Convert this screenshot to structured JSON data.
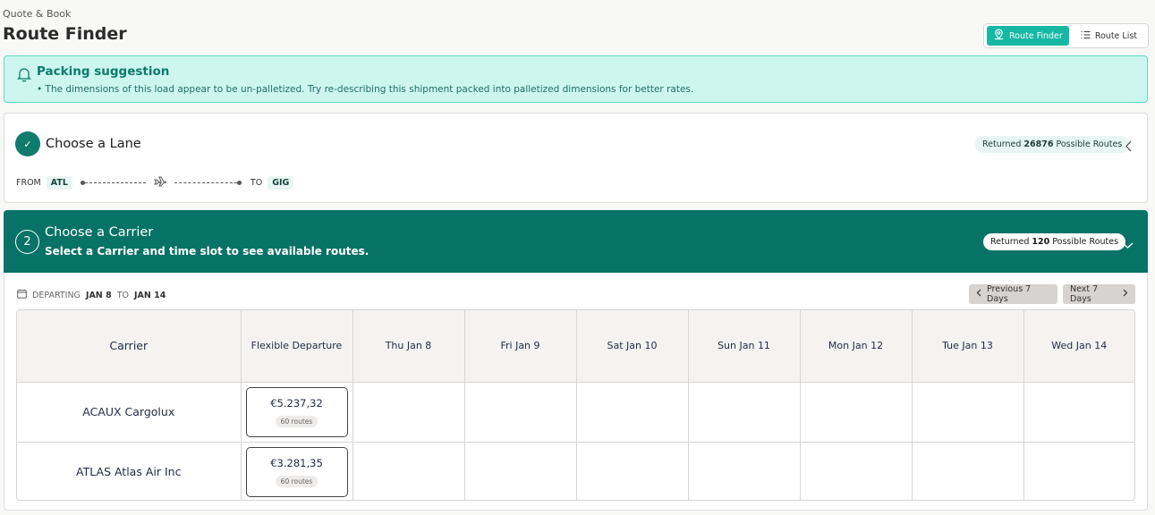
{
  "header": {
    "breadcrumb": "Quote & Book",
    "title": "Route Finder"
  },
  "view_toggle": {
    "route_finder": "Route Finder",
    "route_list": "Route List"
  },
  "alert": {
    "title": "Packing suggestion",
    "text": "• The dimensions of this load appear to be un-palletized. Try re-describing this shipment packed into palletized dimensions for better rates."
  },
  "lane": {
    "title": "Choose a Lane",
    "check_glyph": "✓",
    "returned_prefix": "Returned",
    "returned_count": "26876",
    "returned_suffix": "Possible Routes",
    "from_label": "FROM",
    "from_code": "ATL",
    "to_label": "TO",
    "to_code": "GIG"
  },
  "carrier_step": {
    "step_number": "2",
    "title": "Choose a Carrier",
    "subtitle": "Select a Carrier and time slot to see available routes.",
    "returned_prefix": "Returned",
    "returned_count": "120",
    "returned_suffix": "Possible Routes"
  },
  "schedule": {
    "departing_label": "DEPARTING",
    "from_date": "JAN 8",
    "to_word": "TO",
    "to_date": "JAN 14",
    "prev_label": "Previous 7 Days",
    "next_label": "Next 7 Days"
  },
  "table": {
    "columns": [
      "Carrier",
      "Flexible Departure",
      "Thu Jan 8",
      "Fri Jan 9",
      "Sat Jan 10",
      "Sun Jan 11",
      "Mon Jan 12",
      "Tue Jan 13",
      "Wed Jan 14"
    ],
    "rows": [
      {
        "carrier": "ACAUX Cargolux",
        "price": "€5.237,32",
        "routes": "60 routes"
      },
      {
        "carrier": "ATLAS Atlas Air Inc",
        "price": "€3.281,35",
        "routes": "60 routes"
      }
    ]
  },
  "colors": {
    "teal_dark": "#077266",
    "teal_accent": "#16b8a4",
    "alert_bg": "#cdf7ee"
  }
}
